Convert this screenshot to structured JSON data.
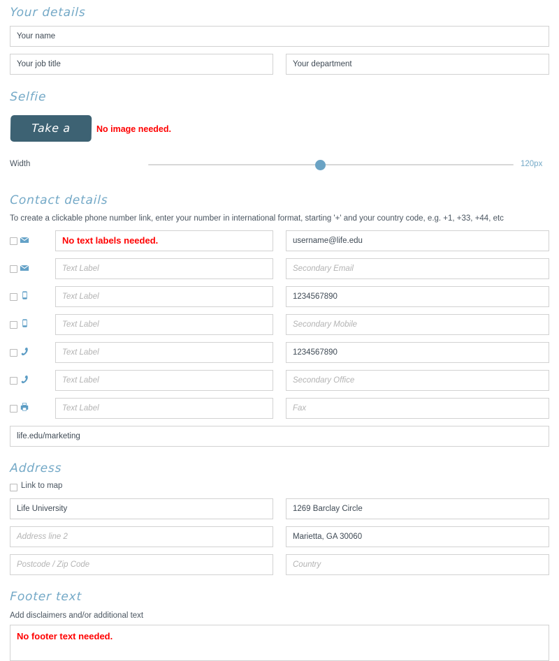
{
  "sections": {
    "your_details": {
      "heading": "Your details",
      "name_value": "Your name",
      "job_title_value": "Your job title",
      "department_value": "Your department"
    },
    "selfie": {
      "heading": "Selfie",
      "button_label": "Take a selfie",
      "note": "No image needed.",
      "width_label": "Width",
      "width_value": "120px",
      "slider_percent": 47
    },
    "contact": {
      "heading": "Contact details",
      "help_text": "To create a clickable phone number link, enter your number in international format, starting '+' and your country code, e.g. +1, +33, +44, etc",
      "rows": [
        {
          "icon": "envelope-icon",
          "label_value": "No text labels needed.",
          "label_is_red": true,
          "label_is_placeholder": false,
          "value": "username@life.edu",
          "value_is_placeholder": false
        },
        {
          "icon": "envelope-icon",
          "label_value": "Text Label",
          "label_is_red": false,
          "label_is_placeholder": true,
          "value": "Secondary Email",
          "value_is_placeholder": true
        },
        {
          "icon": "mobile-icon",
          "label_value": "Text Label",
          "label_is_red": false,
          "label_is_placeholder": true,
          "value": "1234567890",
          "value_is_placeholder": false
        },
        {
          "icon": "mobile-icon",
          "label_value": "Text Label",
          "label_is_red": false,
          "label_is_placeholder": true,
          "value": "Secondary Mobile",
          "value_is_placeholder": true
        },
        {
          "icon": "phone-icon",
          "label_value": "Text Label",
          "label_is_red": false,
          "label_is_placeholder": true,
          "value": "1234567890",
          "value_is_placeholder": false
        },
        {
          "icon": "phone-icon",
          "label_value": "Text Label",
          "label_is_red": false,
          "label_is_placeholder": true,
          "value": "Secondary Office",
          "value_is_placeholder": true
        },
        {
          "icon": "fax-icon",
          "label_value": "Text Label",
          "label_is_red": false,
          "label_is_placeholder": true,
          "value": "Fax",
          "value_is_placeholder": true
        }
      ],
      "website_value": "life.edu/marketing"
    },
    "address": {
      "heading": "Address",
      "link_to_map_label": "Link to map",
      "line1_value": "Life University",
      "line1_right_value": "1269 Barclay Circle",
      "line2_placeholder": "Address line 2",
      "city_state_value": "Marietta, GA 30060",
      "postcode_placeholder": "Postcode / Zip Code",
      "country_placeholder": "Country"
    },
    "footer": {
      "heading": "Footer text",
      "help_text": "Add disclaimers and/or additional text",
      "value": "No footer text needed."
    }
  },
  "colors": {
    "heading": "#74a9c7",
    "button": "#3d6273",
    "alert": "#ff0000",
    "icon": "#5b9cc4",
    "border": "#d2d2d2"
  }
}
